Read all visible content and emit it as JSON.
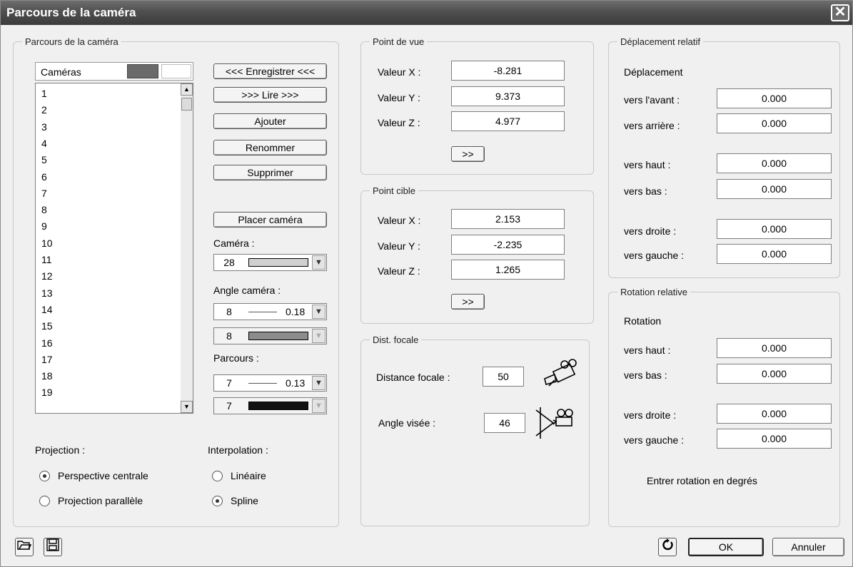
{
  "title": "Parcours de la caméra",
  "path_group": {
    "legend": "Parcours de la caméra",
    "list_header": "Caméras",
    "items": [
      "1",
      "2",
      "3",
      "4",
      "5",
      "6",
      "7",
      "8",
      "9",
      "10",
      "11",
      "12",
      "13",
      "14",
      "15",
      "16",
      "17",
      "18",
      "19"
    ],
    "buttons": {
      "save": "<<< Enregistrer <<<",
      "play": ">>> Lire >>>",
      "add": "Ajouter",
      "rename": "Renommer",
      "delete": "Supprimer",
      "place": "Placer caméra"
    },
    "camera_label": "Caméra :",
    "camera_value": "28",
    "angle_label": "Angle caméra :",
    "angle_value": "8",
    "angle_width": "0.18",
    "angle_color_value": "8",
    "path_label": "Parcours :",
    "path_value": "7",
    "path_width": "0.13",
    "path_color_value": "7",
    "projection_label": "Projection :",
    "projection_options": [
      "Perspective centrale",
      "Projection parallèle"
    ],
    "interpolation_label": "Interpolation :",
    "interpolation_options": [
      "Linéaire",
      "Spline"
    ]
  },
  "viewpoint": {
    "legend": "Point de vue",
    "x_label": "Valeur X :",
    "x": "-8.281",
    "y_label": "Valeur Y :",
    "y": "9.373",
    "z_label": "Valeur Z :",
    "z": "4.977",
    "apply": ">>"
  },
  "target": {
    "legend": "Point cible",
    "x_label": "Valeur X :",
    "x": "2.153",
    "y_label": "Valeur Y :",
    "y": "-2.235",
    "z_label": "Valeur Z :",
    "z": "1.265",
    "apply": ">>"
  },
  "focal": {
    "legend": "Dist. focale",
    "distance_label": "Distance focale :",
    "distance": "50",
    "angle_label": "Angle visée :",
    "angle": "46"
  },
  "relative_move": {
    "legend": "Déplacement relatif",
    "heading": "Déplacement",
    "forward_label": "vers l'avant :",
    "forward": "0.000",
    "backward_label": "vers arrière :",
    "backward": "0.000",
    "up_label": "vers haut :",
    "up": "0.000",
    "down_label": "vers bas :",
    "down": "0.000",
    "right_label": "vers droite :",
    "right": "0.000",
    "left_label": "vers gauche :",
    "left": "0.000"
  },
  "relative_rotation": {
    "legend": "Rotation relative",
    "heading": "Rotation",
    "up_label": "vers haut :",
    "up": "0.000",
    "down_label": "vers bas :",
    "down": "0.000",
    "right_label": "vers droite :",
    "right": "0.000",
    "left_label": "vers gauche :",
    "left": "0.000",
    "note": "Entrer rotation en degrés"
  },
  "footer": {
    "ok": "OK",
    "cancel": "Annuler"
  },
  "colors": {
    "titlebar": "#4f4f4f",
    "camera_swatch": "#d0d0d0",
    "angle_swatch": "#8c8c8c",
    "path_swatch": "#101010",
    "header_swatch": "#6a6a6a"
  }
}
